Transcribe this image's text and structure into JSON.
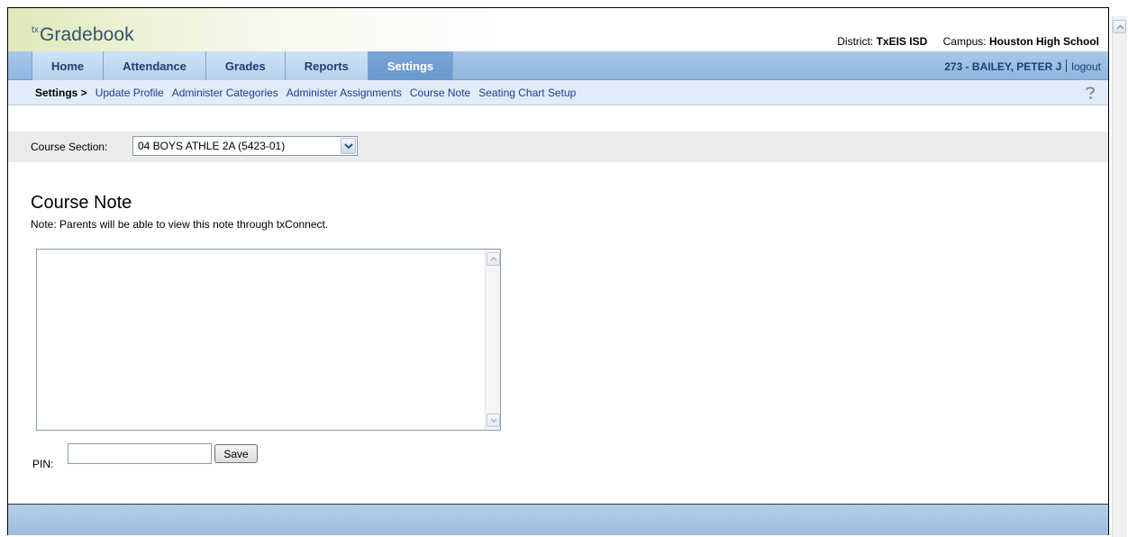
{
  "app": {
    "logo_prefix": "tx",
    "logo_name": "Gradebook",
    "district_label": "District:",
    "district_value": "TxEIS ISD",
    "campus_label": "Campus:",
    "campus_value": "Houston High School"
  },
  "nav": {
    "tabs": [
      {
        "label": "Home",
        "active": false
      },
      {
        "label": "Attendance",
        "active": false
      },
      {
        "label": "Grades",
        "active": false
      },
      {
        "label": "Reports",
        "active": false
      },
      {
        "label": "Settings",
        "active": true
      }
    ],
    "user": "273 - BAILEY, PETER J",
    "logout": "logout"
  },
  "subnav": {
    "crumb": "Settings >",
    "links": [
      "Update Profile",
      "Administer Categories",
      "Administer Assignments",
      "Course Note",
      "Seating Chart Setup"
    ],
    "help_icon": "question-mark-icon"
  },
  "course": {
    "label": "Course Section:",
    "selected": "04 BOYS ATHLE 2A (5423-01)"
  },
  "main": {
    "title": "Course Note",
    "note": "Note: Parents will be able to view this note through txConnect.",
    "note_value": "",
    "pin_label": "PIN:",
    "pin_value": "",
    "save_label": "Save"
  },
  "colors": {
    "nav_tab_text": "#1f3f73",
    "active_tab": "#6a98cd",
    "subnav_bg": "#e2ecf8",
    "link": "#1b3d8f",
    "footer": "#9cbddf"
  }
}
